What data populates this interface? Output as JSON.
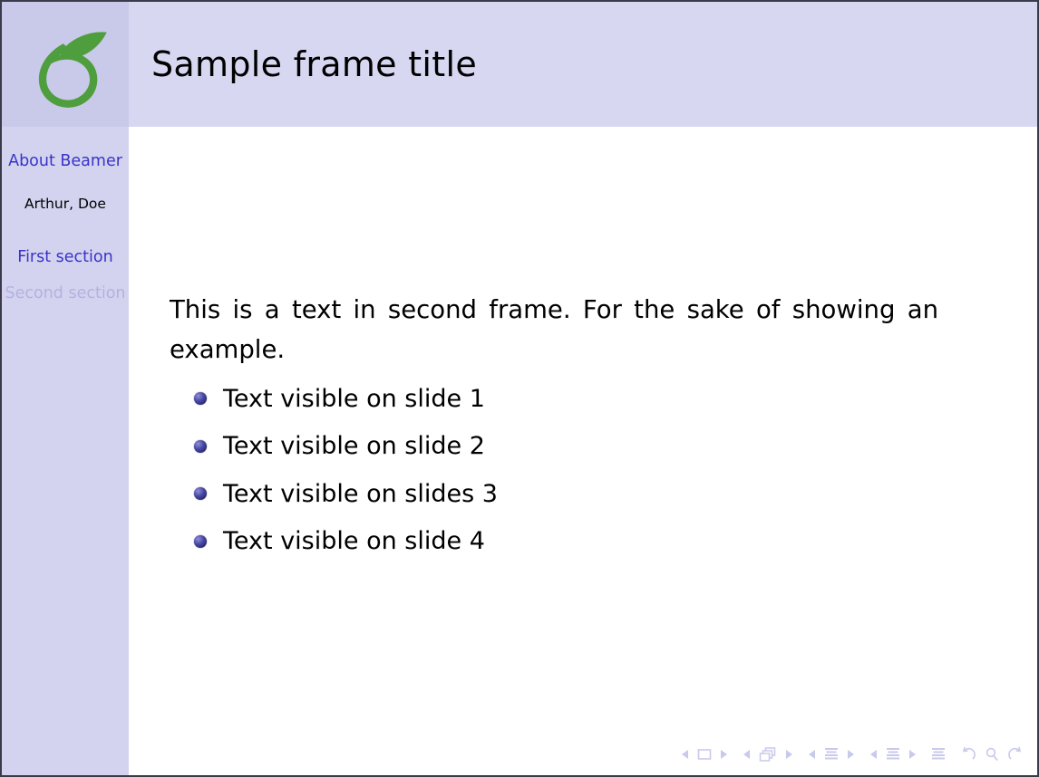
{
  "slide": {
    "logo": "overleaf-logo",
    "frame_title": "Sample frame title",
    "colors": {
      "header_bg": "#d7d7f2",
      "logo_bg": "#c9c9e9",
      "sidebar_bg": "#d3d3ef",
      "body_bg": "#ffffff",
      "link_blue": "#3a33c8",
      "inactive_blue": "#b2b2e2",
      "logo_green": "#4e9e3e",
      "bullet_blue": "#2c2c78",
      "border": "#3a3a4a"
    }
  },
  "sidebar": {
    "title": "About Beamer",
    "author": "Arthur, Doe",
    "sections": [
      {
        "label": "First section",
        "state": "active"
      },
      {
        "label": "Second section",
        "state": "inactive"
      }
    ]
  },
  "body": {
    "paragraph": "This is a text in second frame. For the sake of showing an example.",
    "bullets": [
      {
        "label": "Text visible on slide 1"
      },
      {
        "label": "Text visible on slide 2"
      },
      {
        "label": "Text visible on slides 3"
      },
      {
        "label": "Text visible on slide 4"
      }
    ]
  },
  "navigation": {
    "groups": [
      {
        "name": "slide-navigation",
        "prev": "triangle-left-icon",
        "symbol": "slide-square-icon",
        "next": "triangle-right-icon"
      },
      {
        "name": "frame-navigation",
        "prev": "triangle-left-icon",
        "symbol": "frames-stack-icon",
        "next": "triangle-right-icon"
      },
      {
        "name": "subsection-navigation",
        "prev": "triangle-left-icon",
        "symbol": "subsection-lines-icon",
        "next": "triangle-right-icon"
      },
      {
        "name": "section-navigation",
        "prev": "triangle-left-icon",
        "symbol": "section-lines-icon",
        "next": "triangle-right-icon"
      }
    ],
    "doc_symbol": "document-lines-icon",
    "back_symbol": "back-arrow-icon",
    "search_symbol": "search-magnifier-icon",
    "forward_symbol": "forward-arrow-icon"
  }
}
